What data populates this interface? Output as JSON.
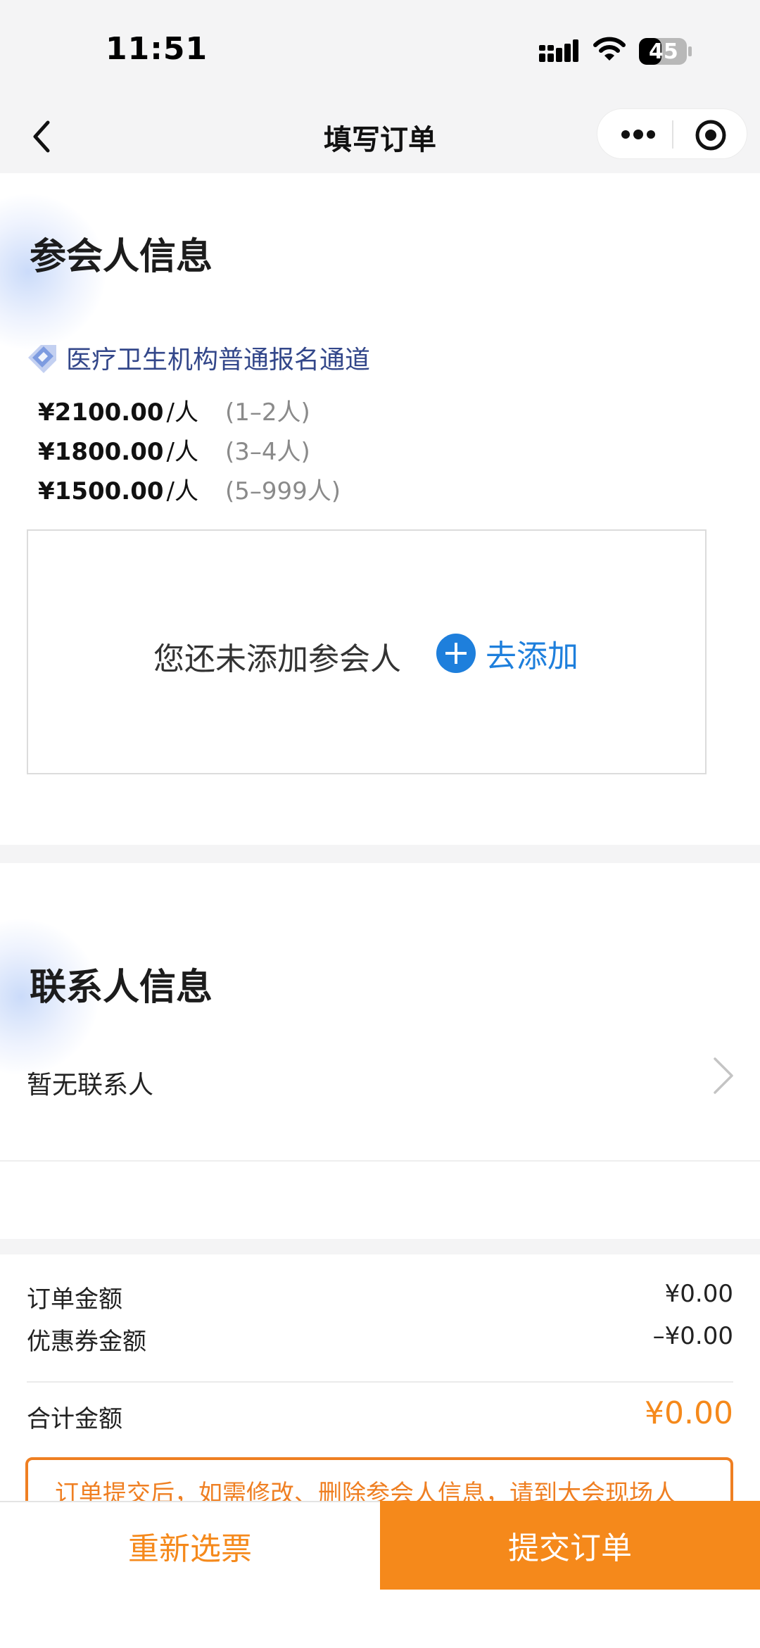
{
  "status_bar": {
    "time": "11:51",
    "battery": "45"
  },
  "nav": {
    "title": "填写订单"
  },
  "attendee_section": {
    "title": "参会人信息",
    "channel": "医疗卫生机构普通报名通道",
    "prices": [
      {
        "amount": "¥2100.00",
        "unit": "/人",
        "range": "(1–2人)"
      },
      {
        "amount": "¥1800.00",
        "unit": "/人",
        "range": "(3–4人)"
      },
      {
        "amount": "¥1500.00",
        "unit": "/人",
        "range": "(5–999人)"
      }
    ],
    "empty_text": "您还未添加参会人",
    "add_label": "去添加"
  },
  "contact_section": {
    "title": "联系人信息",
    "empty_text": "暂无联系人"
  },
  "summary": {
    "order_amount_label": "订单金额",
    "order_amount": "¥0.00",
    "coupon_label": "优惠券金额",
    "coupon_amount": "–¥0.00",
    "total_label": "合计金额",
    "total_amount": "¥0.00",
    "notice": "订单提交后，如需修改、删除参会人信息，请到大会现场人"
  },
  "bottom": {
    "reselect_label": "重新选票",
    "submit_label": "提交订单"
  },
  "colors": {
    "accent_orange": "#f5891b",
    "link_blue": "#1e7fdc",
    "channel_text": "#33478a"
  }
}
